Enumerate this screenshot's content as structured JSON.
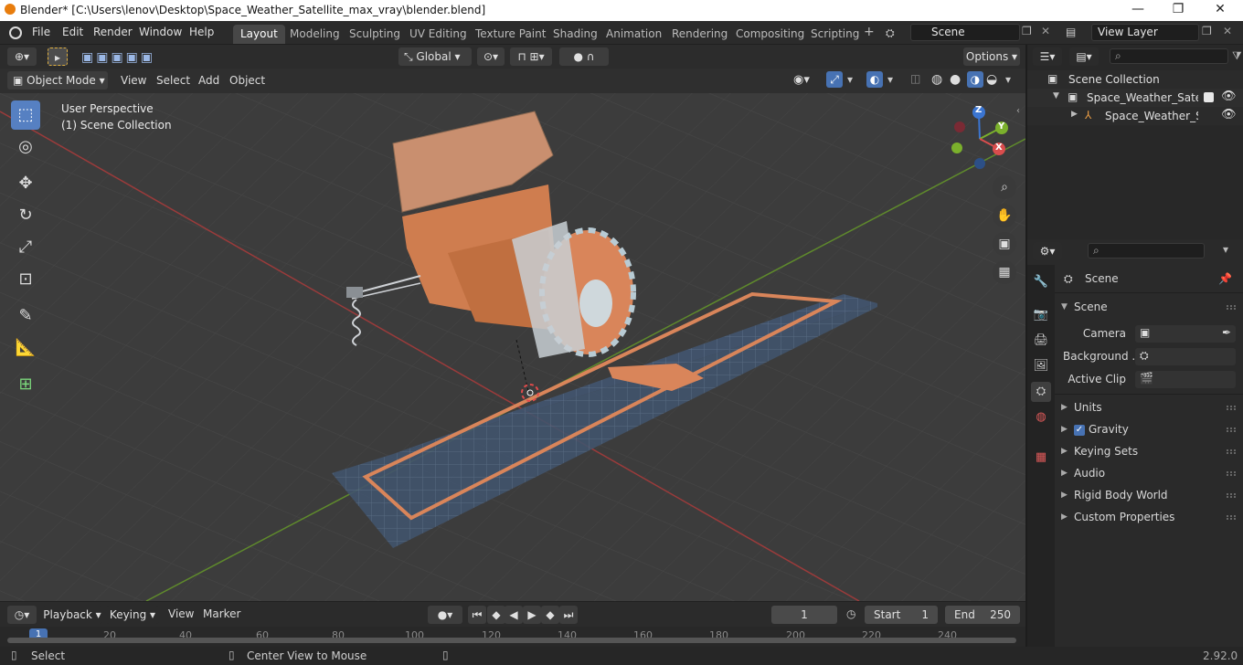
{
  "window": {
    "title": "Blender* [C:\\Users\\lenov\\Desktop\\Space_Weather_Satellite_max_vray\\blender.blend]",
    "min": "—",
    "max": "❐",
    "close": "✕"
  },
  "menu": [
    "File",
    "Edit",
    "Render",
    "Window",
    "Help"
  ],
  "workspaces": [
    "Layout",
    "Modeling",
    "Sculpting",
    "UV Editing",
    "Texture Paint",
    "Shading",
    "Animation",
    "Rendering",
    "Compositing",
    "Scripting"
  ],
  "active_workspace": "Layout",
  "scene_field": "Scene",
  "view_layer_field": "View Layer",
  "viewport_header": {
    "transform": "Global",
    "options": "Options"
  },
  "mode": {
    "object_mode": "Object Mode",
    "view": "View",
    "select": "Select",
    "add": "Add",
    "object": "Object"
  },
  "overlay_text": {
    "perspective": "User Perspective",
    "collection": "(1) Scene Collection"
  },
  "axes": {
    "x": "X",
    "y": "Y",
    "z": "Z"
  },
  "outliner": {
    "root": "Scene Collection",
    "items": [
      {
        "label": "Space_Weather_Satellite"
      },
      {
        "label": "Space_Weather_Sate"
      }
    ]
  },
  "properties": {
    "context": "Scene",
    "section": "Scene",
    "camera_label": "Camera",
    "background_label": "Background ...",
    "clip_label": "Active Clip",
    "panels": [
      "Units",
      "Gravity",
      "Keying Sets",
      "Audio",
      "Rigid Body World",
      "Custom Properties"
    ]
  },
  "timeline": {
    "playback": "Playback",
    "keying": "Keying",
    "view": "View",
    "marker": "Marker",
    "current_frame": "1",
    "start_label": "Start",
    "start": "1",
    "end_label": "End",
    "end": "250",
    "ticks": [
      "1",
      "20",
      "40",
      "60",
      "80",
      "100",
      "120",
      "140",
      "160",
      "180",
      "200",
      "220",
      "240"
    ]
  },
  "status": {
    "select": "Select",
    "center": "Center View to Mouse",
    "version": "2.92.0"
  },
  "colors": {
    "accent": "#4772b3",
    "orange": "#d9855a",
    "panel_blue": "#42536e"
  }
}
